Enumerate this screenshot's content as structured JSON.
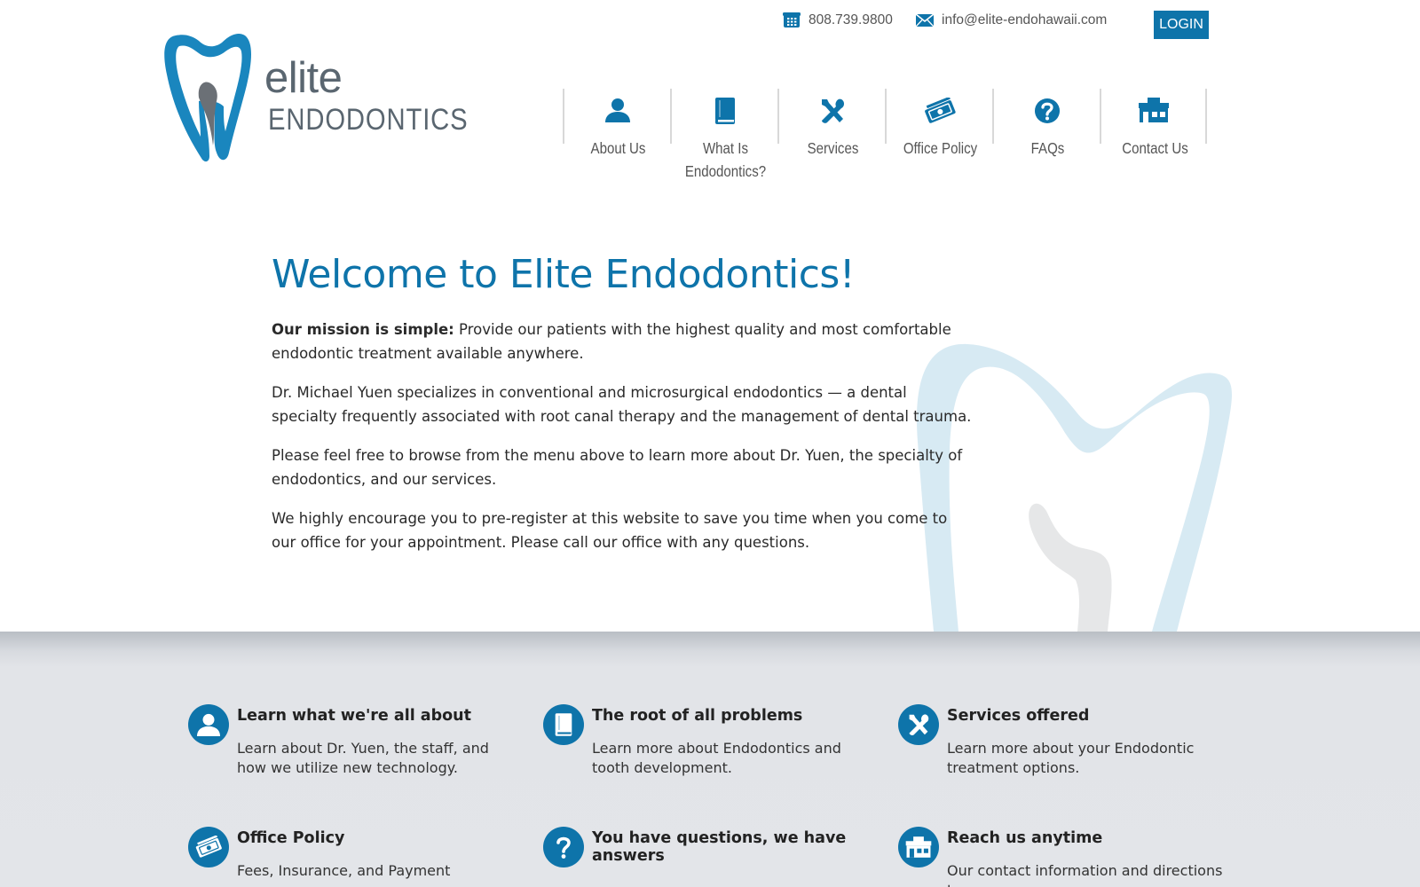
{
  "header": {
    "phone": "808.739.9800",
    "email": "info@elite-endohawaii.com",
    "login_label": "LOGIN",
    "logo": {
      "line1": "elite",
      "line2": "ENDODONTICS"
    }
  },
  "nav": {
    "items": [
      {
        "label": "About Us",
        "icon": "person-icon"
      },
      {
        "label": "What Is Endodontics?",
        "icon": "book-icon"
      },
      {
        "label": "Services",
        "icon": "tools-icon"
      },
      {
        "label": "Office Policy",
        "icon": "money-icon"
      },
      {
        "label": "FAQs",
        "icon": "question-icon"
      },
      {
        "label": "Contact Us",
        "icon": "building-icon"
      }
    ]
  },
  "welcome": {
    "title": "Welcome to Elite Endodontics!",
    "mission_label": "Our mission is simple:",
    "mission_text": " Provide our patients with the highest quality and most comfortable endodontic treatment available anywhere.",
    "p2": "Dr. Michael Yuen specializes in conventional and microsurgical endodontics — a dental specialty frequently associated with root canal therapy and the management of dental trauma.",
    "p3": "Please feel free to browse from the menu above to learn more about Dr. Yuen, the specialty of endodontics, and our services.",
    "p4": "We highly encourage you to pre-register at this website to save you time when you come to our office for your appointment. Please call our office with any questions."
  },
  "features": [
    {
      "title": "Learn what we're all about",
      "desc": "Learn about Dr. Yuen, the staff, and how we utilize new technology.",
      "icon": "person-icon"
    },
    {
      "title": "The root of all problems",
      "desc": "Learn more about Endodontics and tooth development.",
      "icon": "book-icon"
    },
    {
      "title": "Services offered",
      "desc": "Learn more about your Endodontic treatment options.",
      "icon": "tools-icon"
    },
    {
      "title": "Office Policy",
      "desc": "Fees, Insurance, and Payment",
      "icon": "money-icon"
    },
    {
      "title": "You have questions, we have answers",
      "desc": "",
      "icon": "question-icon"
    },
    {
      "title": "Reach us anytime",
      "desc": "Our contact information and directions to",
      "icon": "building-icon"
    }
  ],
  "colors": {
    "brand_blue": "#0e74aa",
    "text_gray": "#555555",
    "band_gray": "#e3e5e9"
  }
}
